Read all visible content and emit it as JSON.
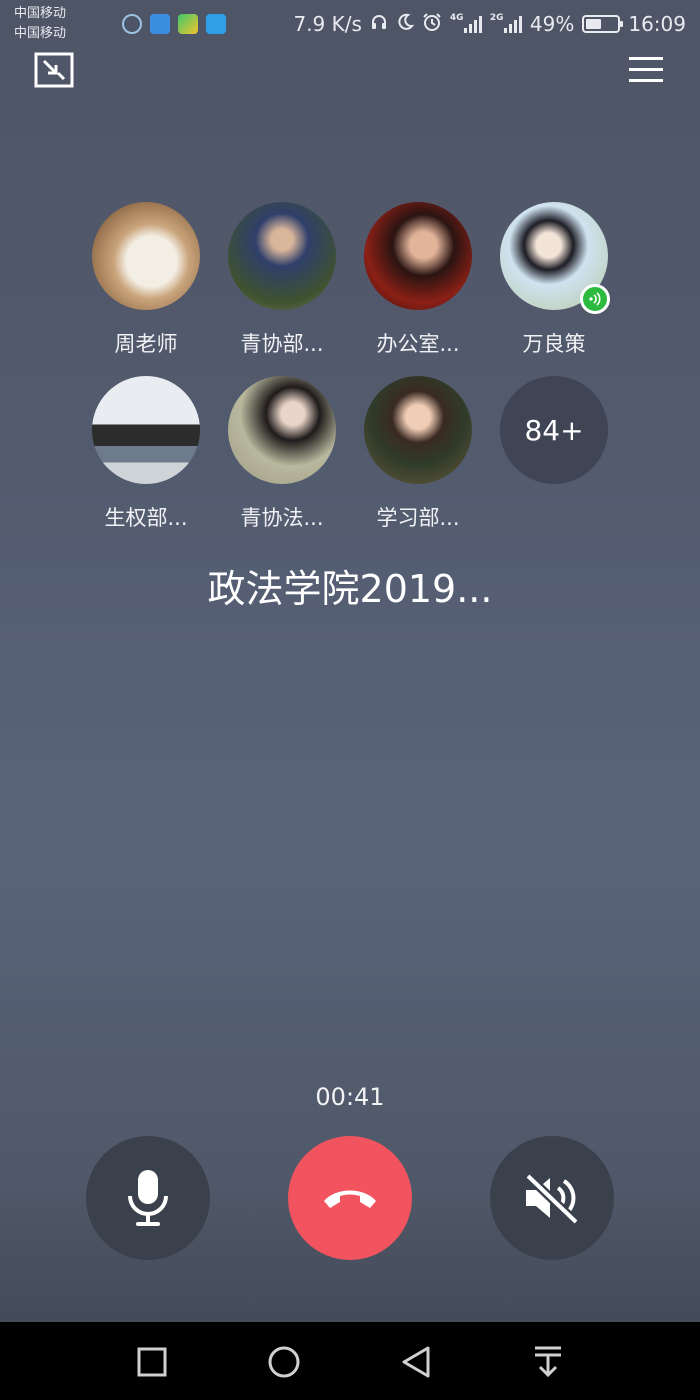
{
  "status_bar": {
    "carrier_1": "中国移动",
    "carrier_2": "中国移动",
    "app_icons": [
      "call-app-icon",
      "store-app-icon",
      "video-app-icon",
      "shield-app-icon"
    ],
    "speed": "7.9 K/s",
    "net_1": "4G",
    "net_2": "2G",
    "battery_text": "49%",
    "battery_level": 0.49,
    "time": "16:09"
  },
  "members": [
    {
      "name": "周老师",
      "avatar": "book-photo"
    },
    {
      "name": "青协部...",
      "avatar": "guitar-singer-photo"
    },
    {
      "name": "办公室...",
      "avatar": "red-portrait-photo"
    },
    {
      "name": "万良策",
      "avatar": "anime-boy-photo",
      "speaking": true
    },
    {
      "name": "生权部...",
      "avatar": "cat-photo"
    },
    {
      "name": "青协法...",
      "avatar": "girl-photo"
    },
    {
      "name": "学习部...",
      "avatar": "child-photo"
    }
  ],
  "more_count": "84+",
  "group_title": "政法学院2019...",
  "call_timer": "00:41",
  "colors": {
    "hangup": "#f2545f",
    "control_bg": "#3b404d",
    "speaking_badge": "#2dbb3f"
  }
}
